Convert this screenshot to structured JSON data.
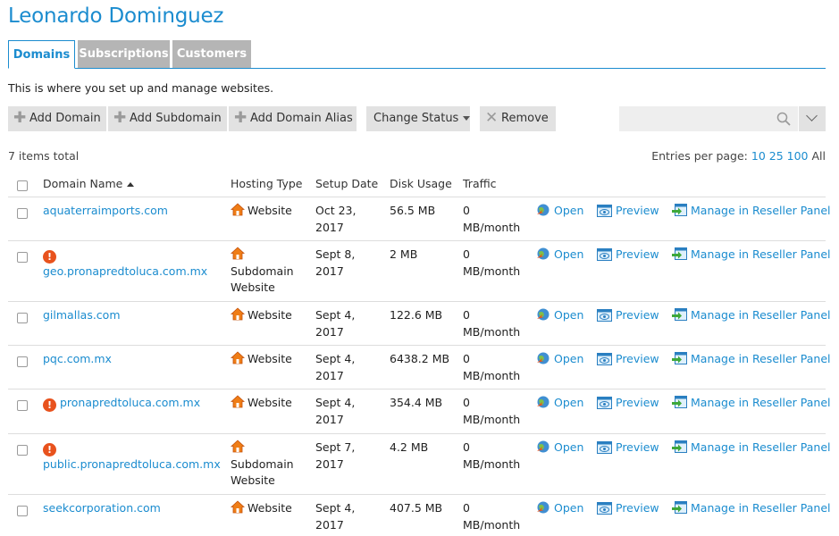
{
  "header": {
    "title": "Leonardo Dominguez"
  },
  "tabs": [
    {
      "label": "Domains",
      "active": true
    },
    {
      "label": "Subscriptions",
      "active": false
    },
    {
      "label": "Customers",
      "active": false
    }
  ],
  "intro": "This is where you set up and manage websites.",
  "toolbar": {
    "add_domain": "Add Domain",
    "add_subdomain": "Add Subdomain",
    "add_alias": "Add Domain Alias",
    "change_status": "Change Status",
    "remove": "Remove"
  },
  "search": {
    "placeholder": ""
  },
  "summary": {
    "total": "7 items total",
    "entries_label": "Entries per page:",
    "page_sizes": [
      "10",
      "25",
      "100",
      "All"
    ]
  },
  "columns": {
    "domain_name": "Domain Name",
    "hosting_type": "Hosting Type",
    "setup_date": "Setup Date",
    "disk_usage": "Disk Usage",
    "traffic": "Traffic"
  },
  "actions": {
    "open": "Open",
    "preview": "Preview",
    "manage": "Manage in Reseller Panel"
  },
  "rows": [
    {
      "domain": "aquaterraimports.com",
      "warning": false,
      "hosting_type": "Website",
      "setup_date": [
        "Oct 23,",
        "2017"
      ],
      "disk": "56.5 MB",
      "traffic": [
        "0",
        "MB/month"
      ]
    },
    {
      "domain": "geo.pronapredtoluca.com.mx",
      "warning": true,
      "hosting_type": "Subdomain Website",
      "setup_date": [
        "Sept 8,",
        "2017"
      ],
      "disk": "2 MB",
      "traffic": [
        "0",
        "MB/month"
      ]
    },
    {
      "domain": "gilmallas.com",
      "warning": false,
      "hosting_type": "Website",
      "setup_date": [
        "Sept 4,",
        "2017"
      ],
      "disk": "122.6 MB",
      "traffic": [
        "0",
        "MB/month"
      ]
    },
    {
      "domain": "pqc.com.mx",
      "warning": false,
      "hosting_type": "Website",
      "setup_date": [
        "Sept 4,",
        "2017"
      ],
      "disk": "6438.2 MB",
      "traffic": [
        "0",
        "MB/month"
      ]
    },
    {
      "domain": "pronapredtoluca.com.mx",
      "warning": true,
      "hosting_type": "Website",
      "setup_date": [
        "Sept 4,",
        "2017"
      ],
      "disk": "354.4 MB",
      "traffic": [
        "0",
        "MB/month"
      ]
    },
    {
      "domain": "public.pronapredtoluca.com.mx",
      "warning": true,
      "hosting_type": "Subdomain Website",
      "setup_date": [
        "Sept 7,",
        "2017"
      ],
      "disk": "4.2 MB",
      "traffic": [
        "0",
        "MB/month"
      ]
    },
    {
      "domain": "seekcorporation.com",
      "warning": false,
      "hosting_type": "Website",
      "setup_date": [
        "Sept 4,",
        "2017"
      ],
      "disk": "407.5 MB",
      "traffic": [
        "0",
        "MB/month"
      ]
    }
  ]
}
